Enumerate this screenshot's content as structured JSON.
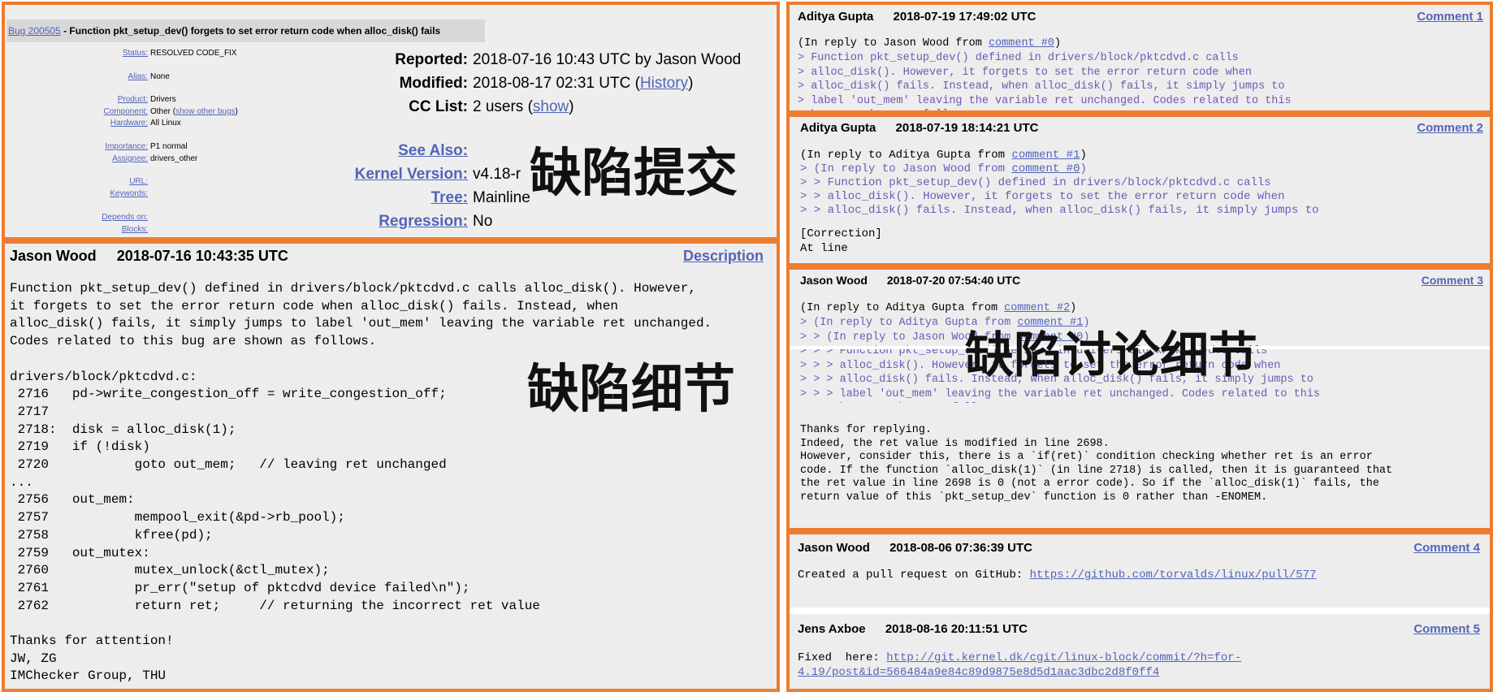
{
  "header": {
    "bug_id": "Bug 200505",
    "bug_summary": " - Function pkt_setup_dev() forgets to set error return code when alloc_disk() fails"
  },
  "fields_small": {
    "status_label": "Status:",
    "status": "RESOLVED CODE_FIX",
    "alias_label": "Alias:",
    "alias": "None",
    "product_label": "Product:",
    "product": "Drivers",
    "component_label": "Component:",
    "component": "Other (",
    "component_link": "show other bugs",
    "component_end": ")",
    "hardware_label": "Hardware:",
    "hardware": "All Linux",
    "importance_label": "Importance:",
    "importance": "P1 normal",
    "assignee_label": "Assignee:",
    "assignee": "drivers_other",
    "url_label": "URL:",
    "keywords_label": "Keywords:",
    "depends_label": "Depends on:",
    "blocks_label": "Blocks:"
  },
  "fields_big": {
    "reported_label": "Reported:",
    "reported": "2018-07-16 10:43 UTC by Jason Wood",
    "modified_label": "Modified:",
    "modified": "2018-08-17 02:31 UTC (",
    "history_link": "History",
    "modified_end": ")",
    "cc_label": "CC List:",
    "cc": "2 users (",
    "cc_link": "show",
    "cc_end": ")",
    "see_also_label": "See Also:",
    "kernel_version_label": "Kernel Version:",
    "kernel_version": "v4.18-r",
    "tree_label": "Tree:",
    "tree": "Mainline",
    "regression_label": "Regression:",
    "regression": "No"
  },
  "overlays": {
    "submission": "缺陷提交",
    "details": "缺陷细节",
    "discussion": "缺陷讨论细节"
  },
  "description": {
    "author": "Jason Wood",
    "time": "2018-07-16 10:43:35 UTC",
    "label": "Description",
    "body": "Function pkt_setup_dev() defined in drivers/block/pktcdvd.c calls alloc_disk(). However,\nit forgets to set the error return code when alloc_disk() fails. Instead, when\nalloc_disk() fails, it simply jumps to label 'out_mem' leaving the variable ret unchanged.\nCodes related to this bug are shown as follows.\n\ndrivers/block/pktcdvd.c:\n 2716   pd->write_congestion_off = write_congestion_off;\n 2717\n 2718:  disk = alloc_disk(1);\n 2719   if (!disk)\n 2720           goto out_mem;   // leaving ret unchanged\n...\n 2756   out_mem:\n 2757           mempool_exit(&pd->rb_pool);\n 2758           kfree(pd);\n 2759   out_mutex:\n 2760           mutex_unlock(&ctl_mutex);\n 2761           pr_err(\"setup of pktcdvd device failed\\n\");\n 2762           return ret;     // returning the incorrect ret value\n\nThanks for attention!\nJW, ZG\nIMChecker Group, THU"
  },
  "comments": [
    {
      "author": "Aditya Gupta",
      "time": "2018-07-19 17:49:02 UTC",
      "label": "Comment 1",
      "reply_prefix": "(In reply to Jason Wood from ",
      "reply_link": "comment #0",
      "reply_end": ")",
      "quoted": "> Function pkt_setup_dev() defined in drivers/block/pktcdvd.c calls\n> alloc_disk(). However, it forgets to set the error return code when\n> alloc_disk() fails. Instead, when alloc_disk() fails, it simply jumps to\n> label 'out_mem' leaving the variable ret unchanged. Codes related to this\n> bug are shown as follows."
    },
    {
      "author": "Aditya Gupta",
      "time": "2018-07-19 18:14:21 UTC",
      "label": "Comment 2",
      "reply_prefix": "(In reply to Aditya Gupta from ",
      "reply_link": "comment #1",
      "reply_end": ")",
      "quoted_prefix": "> (In reply to Jason Wood from ",
      "quoted_link": "comment #0",
      "quoted_end": ")",
      "quoted": "> > Function pkt_setup_dev() defined in drivers/block/pktcdvd.c calls\n> > alloc_disk(). However, it forgets to set the error return code when\n> > alloc_disk() fails. Instead, when alloc_disk() fails, it simply jumps to",
      "body": "[Correction]\nAt line"
    },
    {
      "author": "Jason Wood",
      "time": "2018-07-20 07:54:40 UTC",
      "label": "Comment 3",
      "reply_prefix": "(In reply to Aditya Gupta from ",
      "reply_link": "comment #2",
      "reply_end": ")",
      "q1_prefix": "> (In reply to Aditya Gupta from ",
      "q1_link": "comment #1",
      "q1_end": ")",
      "q2_prefix": "> > (In reply to Jason Wood from ",
      "q2_link": "comment #0",
      "q2_end": ")",
      "quoted": "> > > Function pkt_setup_dev() defined in drivers/block/pktcdvd.c calls\n> > > alloc_disk(). However, it forgets to set the error return code when\n> > > alloc_disk() fails. Instead, when alloc_disk() fails, it simply jumps to\n> > > label 'out_mem' leaving the variable ret unchanged. Codes related to this\n> > > bug are shown as follows.",
      "body": "Thanks for replying.\nIndeed, the ret value is modified in line 2698.\nHowever, consider this, there is a `if(ret)` condition checking whether ret is an error\ncode. If the function `alloc_disk(1)` (in line 2718) is called, then it is guaranteed that\nthe ret value in line 2698 is 0 (not a error code). So if the `alloc_disk(1)` fails, the\nreturn value of this `pkt_setup_dev` function is 0 rather than -ENOMEM."
    },
    {
      "author": "Jason Wood",
      "time": "2018-08-06 07:36:39 UTC",
      "label": "Comment 4",
      "body_prefix": "Created a pull request on GitHub: ",
      "body_link": "https://github.com/torvalds/linux/pull/577"
    },
    {
      "author": "Jens Axboe",
      "time": "2018-08-16 20:11:51 UTC",
      "label": "Comment 5",
      "body_prefix": "Fixed  here: ",
      "body_link_1": "http://git.kernel.dk/cgit/linux-block/commit/?h=for-",
      "body_link_2": "4.19/post&id=566484a9e84c89d9875e8d5d1aac3dbc2d8f0ff4"
    }
  ]
}
